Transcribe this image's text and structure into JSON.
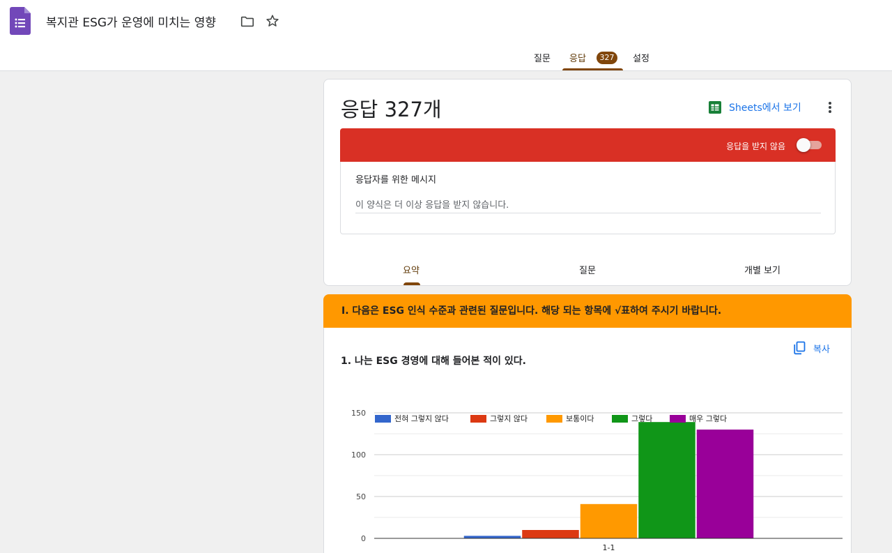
{
  "header": {
    "title": "복지관 ESG가 운영에 미치는 영향",
    "tabs": {
      "questions": "질문",
      "responses": "응답",
      "responses_count": "327",
      "settings": "설정"
    }
  },
  "summary": {
    "heading": "응답 327개",
    "sheets_link": "Sheets에서 보기",
    "closed_label": "응답을 받지 않음",
    "accepting_responses": false,
    "message_label": "응답자를 위한 메시지",
    "message_value": "이 양식은 더 이상 응답을 받지 않습니다.",
    "subtabs": {
      "summary": "요약",
      "question": "질문",
      "individual": "개별 보기"
    }
  },
  "section": {
    "title": "Ⅰ. 다음은 ESG 인식 수준과 관련된 질문입니다. 해당 되는 항목에 √표하여 주시기 바랍니다."
  },
  "question": {
    "title": "1. 나는 ESG 경영에 대해 들어본 적이 있다.",
    "copy_label": "복사"
  },
  "colors": {
    "accent": "#80460b",
    "banner": "#d93025",
    "section": "#ff9800",
    "link": "#1a73e8"
  },
  "icons": {
    "logo": "google-forms-icon",
    "folder": "folder-icon",
    "star": "star-icon",
    "sheets": "sheets-icon",
    "more": "more-vert-icon",
    "copy": "copy-icon"
  },
  "chart_data": {
    "type": "bar",
    "categories": [
      "1-1"
    ],
    "series": [
      {
        "name": "전혀 그렇지 않다",
        "values": [
          3
        ],
        "color": "#3366cc"
      },
      {
        "name": "그렇지 않다",
        "values": [
          10
        ],
        "color": "#dc3912"
      },
      {
        "name": "보통이다",
        "values": [
          41
        ],
        "color": "#ff9900"
      },
      {
        "name": "그렇다",
        "values": [
          139
        ],
        "color": "#109618"
      },
      {
        "name": "매우 그렇다",
        "values": [
          130
        ],
        "color": "#990099"
      }
    ],
    "y_ticks": [
      "0",
      "50",
      "100",
      "150"
    ],
    "ylim": [
      0,
      150
    ],
    "grid": true,
    "legend_position": "top"
  }
}
